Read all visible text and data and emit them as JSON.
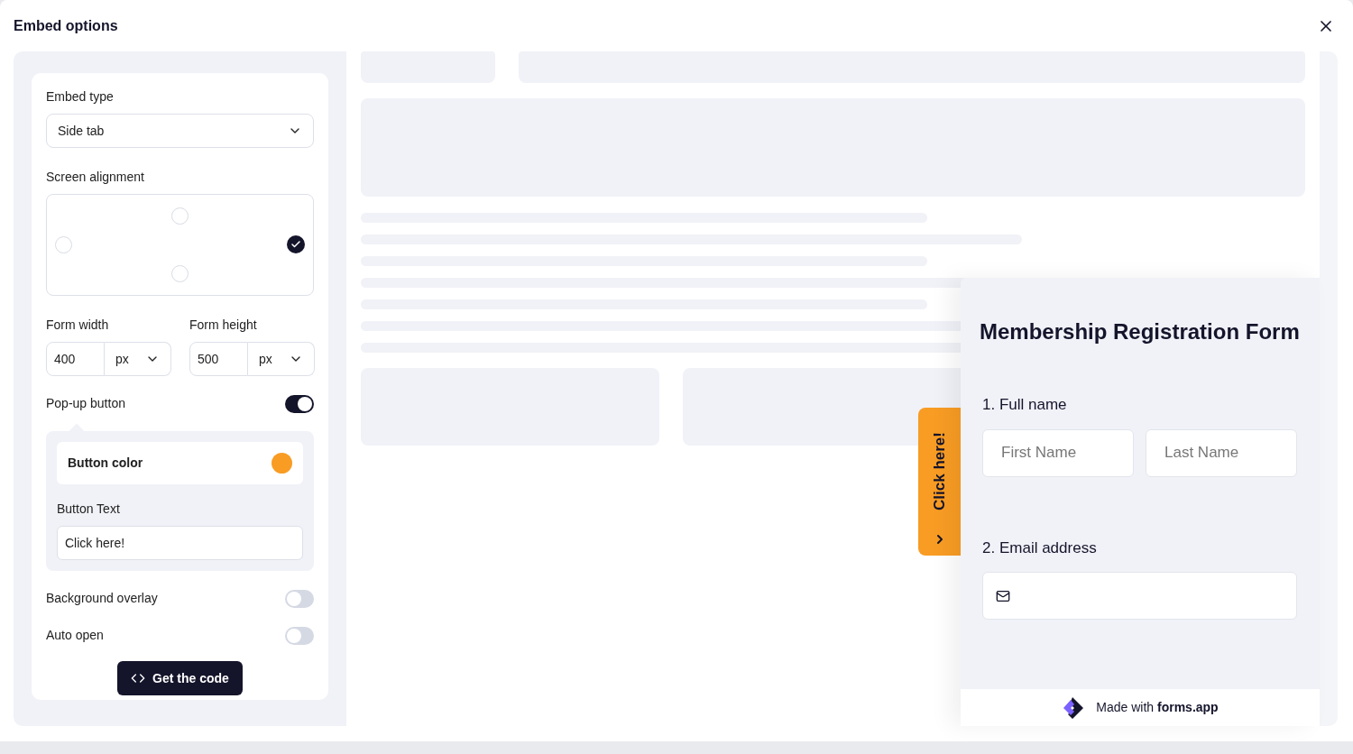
{
  "dialog": {
    "title": "Embed options"
  },
  "settings": {
    "embed_type": {
      "label": "Embed type",
      "value": "Side tab"
    },
    "alignment": {
      "label": "Screen alignment",
      "options": [
        {
          "kind": "top",
          "selected": false
        },
        {
          "kind": "left",
          "selected": false
        },
        {
          "kind": "right",
          "selected": true
        },
        {
          "kind": "bottom",
          "selected": false
        }
      ]
    },
    "form_width": {
      "label": "Form width",
      "value": "400",
      "unit": "px"
    },
    "form_height": {
      "label": "Form height",
      "value": "500",
      "unit": "px"
    },
    "popup_button": {
      "label": "Pop-up button",
      "on": true,
      "button_color": {
        "label": "Button color",
        "color": "#f89c24"
      },
      "button_text": {
        "label": "Button Text",
        "value": "Click here!"
      }
    },
    "toggles": [
      {
        "label": "Background overlay",
        "on": false
      },
      {
        "label": "Auto open",
        "on": false
      }
    ],
    "get_code_button": "Get the code"
  },
  "preview": {
    "side_tab": {
      "label": "Click here!"
    },
    "form": {
      "title": "Membership Registration Form",
      "questions": [
        {
          "number": "1.",
          "label": "Full name",
          "kind": "name",
          "fields": [
            {
              "placeholder": "First Name"
            },
            {
              "placeholder": "Last Name"
            }
          ]
        },
        {
          "number": "2.",
          "label": "Email address",
          "kind": "email"
        }
      ],
      "footer": "Made with **forms.app**"
    }
  }
}
